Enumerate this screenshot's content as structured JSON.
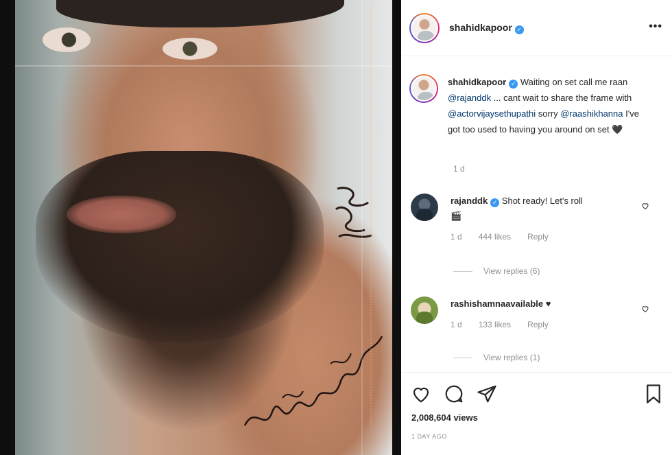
{
  "post": {
    "username": "shahidkapoor",
    "verified_icon": "verified-badge-icon",
    "more_icon": "more-options-icon"
  },
  "caption": {
    "username": "shahidkapoor",
    "text_before_1": " Waiting on set call me raan ",
    "mention_1": "@rajanddk",
    "text_before_2": " ... cant wait to share the frame with ",
    "mention_2": "@actorvijaysethupathi",
    "text_before_3": " sorry ",
    "mention_3": "@raashikhanna",
    "text_after": " I've got too used to having you around on set",
    "emoji": "🖤",
    "time": "1 d"
  },
  "comments": [
    {
      "username": "rajanddk",
      "text": " Shot ready! Let's roll",
      "emoji": "🎬",
      "time": "1 d",
      "likes": "444 likes",
      "reply": "Reply",
      "view_replies": "View replies (6)"
    },
    {
      "username": "rashishamnaavailable",
      "text": " ",
      "emoji": "♥",
      "time": "1 d",
      "likes": "133 likes",
      "reply": "Reply",
      "view_replies": "View replies (1)"
    }
  ],
  "actions": {
    "views": "2,008,604 views",
    "posted": "1 DAY AGO"
  },
  "colors": {
    "text": "#262626",
    "muted": "#8e8e8e",
    "link": "#00376b",
    "verified": "#3897f0"
  }
}
